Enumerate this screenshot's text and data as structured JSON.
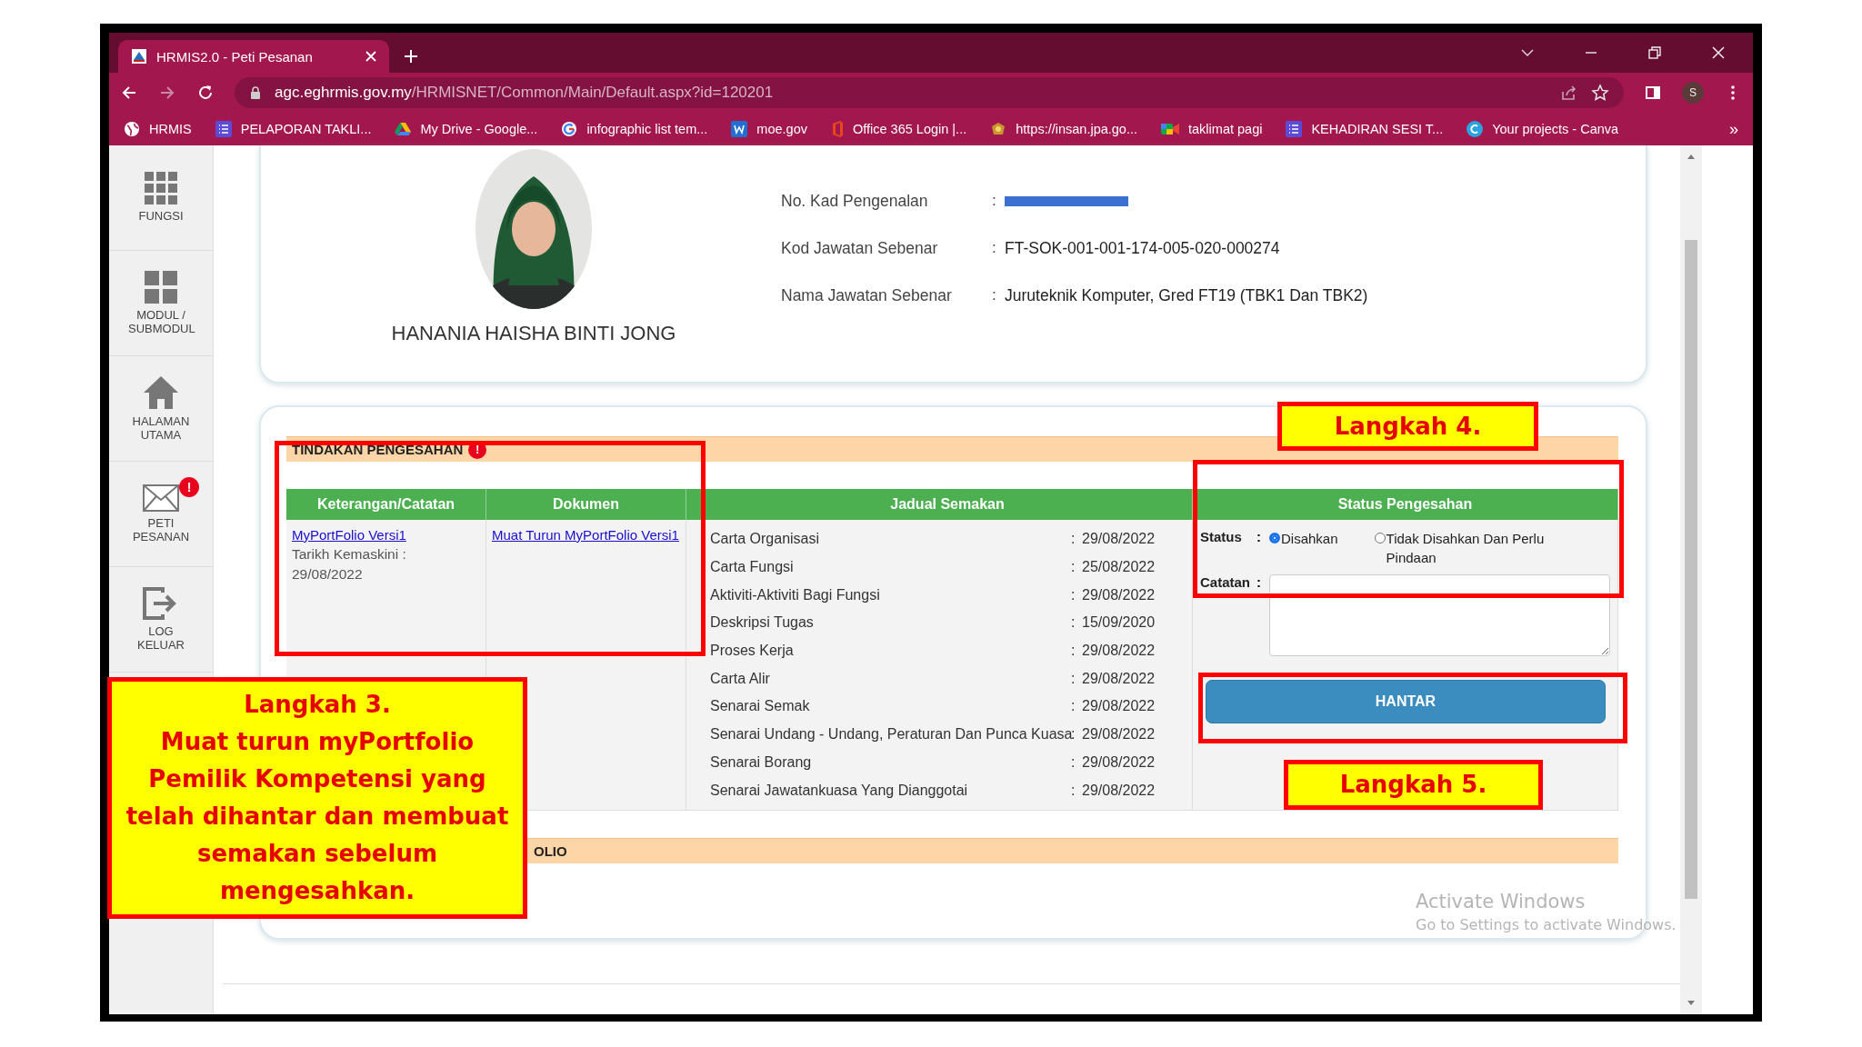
{
  "browser": {
    "tab_title": "HRMIS2.0 - Peti Pesanan",
    "url_domain": "agc.eghrmis.gov.my",
    "url_path": "/HRMISNET/Common/Main/Default.aspx?id=120201",
    "profile_initial": "S",
    "overflow": "»",
    "bookmarks": [
      {
        "label": "HRMIS",
        "kind": "globe"
      },
      {
        "label": "PELAPORAN TAKLI...",
        "kind": "list"
      },
      {
        "label": "My Drive - Google...",
        "kind": "drive"
      },
      {
        "label": "infographic list tem...",
        "kind": "google"
      },
      {
        "label": "moe.gov",
        "kind": "word"
      },
      {
        "label": "Office 365 Login |...",
        "kind": "office"
      },
      {
        "label": "https://insan.jpa.go...",
        "kind": "crest"
      },
      {
        "label": "taklimat pagi",
        "kind": "meet"
      },
      {
        "label": "KEHADIRAN SESI T...",
        "kind": "list"
      },
      {
        "label": "Your projects - Canva",
        "kind": "canva"
      }
    ]
  },
  "sidebar": {
    "items": [
      {
        "label": "FUNGSI",
        "kind": "grid"
      },
      {
        "label": "MODUL / SUBMODUL",
        "kind": "tiles"
      },
      {
        "label": "HALAMAN UTAMA",
        "kind": "home"
      },
      {
        "label": "PETI PESANAN",
        "kind": "mail",
        "badge": "!"
      },
      {
        "label": "LOG KELUAR",
        "kind": "logout"
      }
    ]
  },
  "profile": {
    "name": "HANANIA HAISHA BINTI JONG",
    "fields": [
      {
        "label": "No. Kad Pengenalan",
        "colon": ":",
        "redacted": true
      },
      {
        "label": "Kod Jawatan Sebenar",
        "colon": ":",
        "redacted": false,
        "value": "FT-SOK-001-001-174-005-020-000274"
      },
      {
        "label": "Nama Jawatan Sebenar",
        "colon": ":",
        "redacted": false,
        "value": "Juruteknik Komputer, Gred FT19 (TBK1 Dan TBK2)"
      }
    ]
  },
  "approval": {
    "title": "TINDAKAN PENGESAHAN",
    "badge": "!",
    "columns": [
      "Keterangan/Catatan",
      "Dokumen",
      "Jadual Semakan",
      "Status Pengesahan"
    ],
    "note": {
      "link": "MyPortFolio Versi1",
      "updated_label": "Tarikh Kemaskini :",
      "updated_date": "29/08/2022"
    },
    "document_link": "Muat Turun MyPortFolio Versi1",
    "schedule": [
      {
        "item": "Carta Organisasi",
        "colon": ":",
        "date": "29/08/2022"
      },
      {
        "item": "Carta Fungsi",
        "colon": ":",
        "date": "25/08/2022"
      },
      {
        "item": "Aktiviti-Aktiviti Bagi Fungsi",
        "colon": ":",
        "date": "29/08/2022"
      },
      {
        "item": "Deskripsi Tugas",
        "colon": ":",
        "date": "15/09/2020"
      },
      {
        "item": "Proses Kerja",
        "colon": ":",
        "date": "29/08/2022"
      },
      {
        "item": "Carta Alir",
        "colon": ":",
        "date": "29/08/2022"
      },
      {
        "item": "Senarai Semak",
        "colon": ":",
        "date": "29/08/2022"
      },
      {
        "item": "Senarai Undang - Undang, Peraturan Dan Punca Kuasa",
        "colon": ":",
        "date": "29/08/2022"
      },
      {
        "item": "Senarai Borang",
        "colon": ":",
        "date": "29/08/2022"
      },
      {
        "item": "Senarai Jawatankuasa Yang Dianggotai",
        "colon": ":",
        "date": "29/08/2022"
      }
    ],
    "status": {
      "label": "Status",
      "label_colon": ":",
      "options": [
        {
          "label": "Disahkan",
          "selected": true
        },
        {
          "label": "Tidak Disahkan Dan Perlu Pindaan",
          "selected": false
        }
      ],
      "notes_label": "Catatan",
      "notes_colon": ":"
    },
    "submit": "HANTAR"
  },
  "portfolio_section": {
    "title": "OLIO"
  },
  "os_notice": {
    "title": "Activate Windows",
    "text": "Go to Settings to activate Windows."
  },
  "callouts": [
    {
      "lines": [
        "Langkah 3.",
        "Muat turun myPortfolio",
        "Pemilik Kompetensi yang",
        "telah dihantar dan membuat",
        "semakan sebelum",
        "mengesahkan."
      ]
    },
    {
      "lines": [
        "Langkah 4."
      ]
    },
    {
      "lines": [
        "Langkah 5."
      ]
    }
  ]
}
